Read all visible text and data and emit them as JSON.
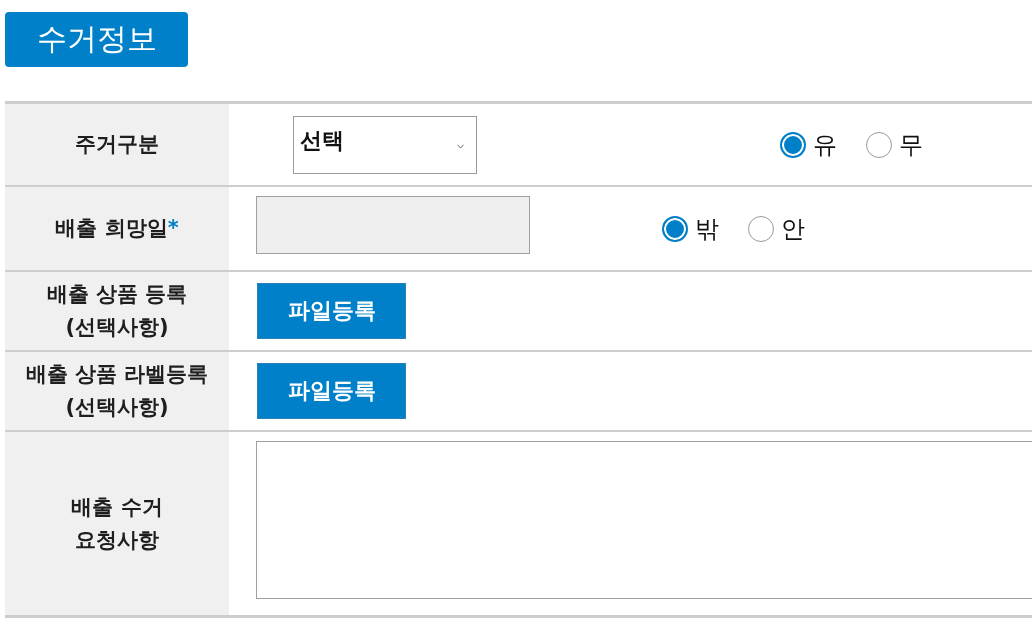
{
  "title": "수거정보",
  "rows": [
    {
      "kind": "select_radio",
      "label": "주거구분",
      "select": {
        "value": "선택"
      },
      "options": [
        {
          "label": "유",
          "selected": true
        },
        {
          "label": "무",
          "selected": false
        }
      ]
    },
    {
      "kind": "date_radio",
      "label": "배출 희망일",
      "required_mark": "*",
      "options": [
        {
          "label": "밖",
          "selected": true
        },
        {
          "label": "안",
          "selected": false
        }
      ]
    },
    {
      "kind": "file",
      "label": "배출 상품 등록\n(선택사항)",
      "button": "파일등록"
    },
    {
      "kind": "file",
      "label": "배출 상품 라벨등록\n(선택사항)",
      "button": "파일등록"
    },
    {
      "kind": "textarea",
      "label": "배출 수거\n요청사항"
    }
  ]
}
